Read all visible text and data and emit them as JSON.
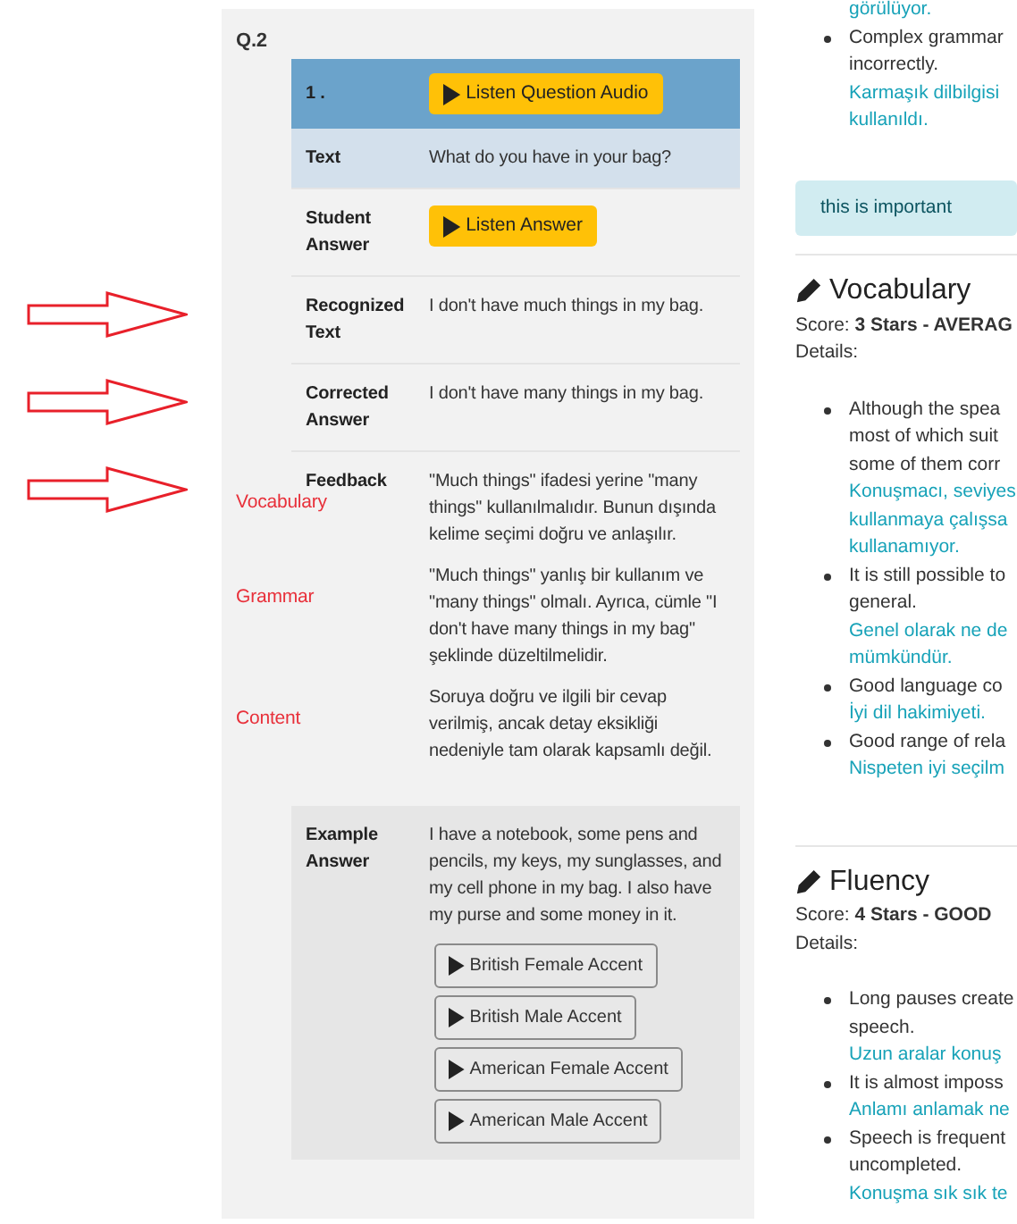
{
  "question": {
    "label": "Q.2",
    "header": {
      "number": "1 .",
      "button": "Listen Question Audio"
    },
    "rows": [
      {
        "kind": "text",
        "label": "Text",
        "value": "What do you have in your bag?",
        "highlighted": true,
        "arrow": false
      },
      {
        "kind": "button",
        "label": "Student Answer",
        "button": "Listen Answer",
        "highlighted": false,
        "arrow": false
      },
      {
        "kind": "text",
        "label": "Recognized Text",
        "value": "I don't have much things in my bag.",
        "highlighted": false,
        "arrow": true
      },
      {
        "kind": "text",
        "label": "Corrected Answer",
        "value": "I don't have many things in my bag.",
        "highlighted": false,
        "arrow": true
      },
      {
        "kind": "feedback",
        "label": "Feedback",
        "highlighted": false,
        "arrow": true,
        "paragraphs": [
          {
            "annotation": "Vocabulary",
            "text": "\"Much things\" ifadesi yerine \"many things\" kullanılmalıdır. Bunun dışında kelime seçimi doğru ve anlaşılır."
          },
          {
            "annotation": "Grammar",
            "text": "\"Much things\" yanlış bir kullanım ve \"many things\" olmalı. Ayrıca, cümle \"I don't have many things in my bag\" şeklinde düzeltilmelidir."
          },
          {
            "annotation": "Content",
            "text": "Soruya doğru ve ilgili bir cevap verilmiş, ancak detay eksikliği nedeniyle tam olarak kapsamlı değil."
          }
        ]
      }
    ],
    "example": {
      "label": "Example Answer",
      "text": "I have a notebook, some pens and pencils, my keys, my sunglasses, and my cell phone in my bag. I also have my purse and some money in it.",
      "buttons": [
        "British Female Accent",
        "British Male Accent",
        "American Female Accent",
        "American Male Accent"
      ]
    }
  },
  "report": {
    "top_items": [
      {
        "kind": "continuation",
        "translation": [
          "görülüyor."
        ]
      },
      {
        "kind": "bullet",
        "lines": [
          "Complex grammar",
          "incorrectly."
        ],
        "translation": [
          "Karmaşık dilbilgisi",
          "kullanıldı."
        ]
      }
    ],
    "alert": "this is important",
    "sections": [
      {
        "title": "Vocabulary",
        "score": "Score: **3 Stars - AVERAG**",
        "details": "Details:",
        "items": [
          {
            "kind": "bullet",
            "lines": [
              "Although the spea",
              "most of which suit",
              "some of them corr"
            ],
            "translation": [
              "Konuşmacı, seviyes",
              "kullanmaya çalışsa",
              "kullanamıyor."
            ]
          },
          {
            "kind": "bullet",
            "lines": [
              "It is still possible to",
              "general."
            ],
            "translation": [
              "Genel olarak ne de",
              "mümkündür."
            ]
          },
          {
            "kind": "bullet",
            "lines": [
              "Good language co"
            ],
            "translation": [
              "İyi dil hakimiyeti."
            ]
          },
          {
            "kind": "bullet",
            "lines": [
              "Good range of rela"
            ],
            "translation": [
              "Nispeten iyi seçilm"
            ]
          }
        ]
      },
      {
        "title": "Fluency",
        "score": "Score: **4 Stars - GOOD**",
        "details": "Details:",
        "items": [
          {
            "kind": "bullet",
            "lines": [
              "Long pauses create",
              "speech."
            ],
            "translation": [
              "Uzun aralar konuş"
            ]
          },
          {
            "kind": "bullet",
            "lines": [
              "It is almost imposs"
            ],
            "translation": [
              "Anlamı anlamak ne"
            ]
          },
          {
            "kind": "bullet",
            "lines": [
              "Speech is frequent",
              "uncompleted."
            ],
            "translation": [
              "Konuşma sık sık te"
            ]
          }
        ]
      }
    ]
  }
}
